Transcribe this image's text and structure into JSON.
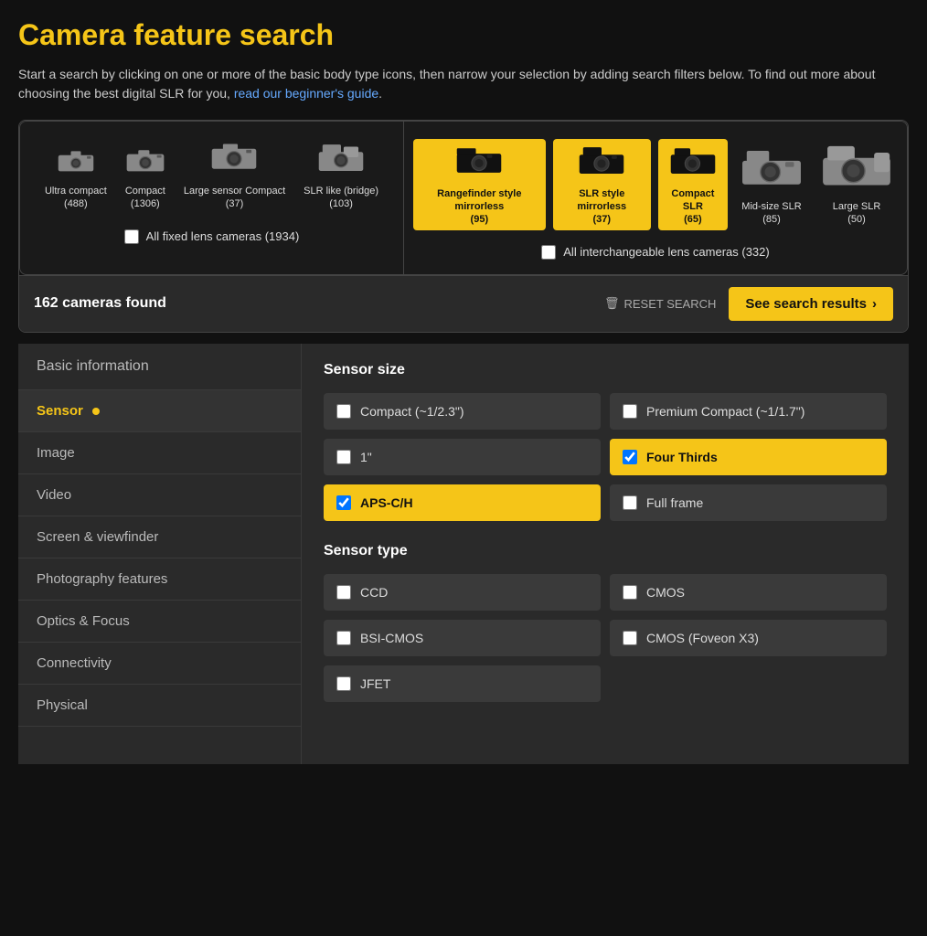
{
  "page": {
    "title": "Camera feature search",
    "description": "Start a search by clicking on one or more of the basic body type icons, then narrow your selection by adding search filters below. To find out more about choosing the best digital SLR for you,",
    "link_text": "read our beginner's guide",
    "cameras_found": "162 cameras found",
    "reset_label": "RESET SEARCH",
    "see_results_label": "See search results"
  },
  "fixed_cameras": [
    {
      "label": "Ultra compact",
      "count": "(488)",
      "selected": false,
      "size": "sm"
    },
    {
      "label": "Compact",
      "count": "(1306)",
      "selected": false,
      "size": "sm"
    },
    {
      "label": "Large sensor Compact",
      "count": "(37)",
      "selected": false,
      "size": "md"
    },
    {
      "label": "SLR like (bridge)",
      "count": "(103)",
      "selected": false,
      "size": "md"
    }
  ],
  "interchangeable_cameras": [
    {
      "label": "Rangefinder style mirrorless",
      "count": "(95)",
      "selected": true,
      "size": "md"
    },
    {
      "label": "SLR style mirrorless",
      "count": "(37)",
      "selected": true,
      "size": "md"
    },
    {
      "label": "Compact SLR",
      "count": "(65)",
      "selected": true,
      "size": "md"
    },
    {
      "label": "Mid-size SLR",
      "count": "(85)",
      "selected": false,
      "size": "lg"
    },
    {
      "label": "Large SLR",
      "count": "(50)",
      "selected": false,
      "size": "xl"
    }
  ],
  "all_fixed_label": "All fixed lens cameras (1934)",
  "all_interchangeable_label": "All interchangeable lens cameras (332)",
  "sidebar": {
    "section_header": "Basic information",
    "items": [
      {
        "id": "sensor",
        "label": "Sensor",
        "active": true,
        "has_dot": true
      },
      {
        "id": "image",
        "label": "Image",
        "active": false,
        "has_dot": false
      },
      {
        "id": "video",
        "label": "Video",
        "active": false,
        "has_dot": false
      },
      {
        "id": "screen-viewfinder",
        "label": "Screen & viewfinder",
        "active": false,
        "has_dot": false
      },
      {
        "id": "photography-features",
        "label": "Photography features",
        "active": false,
        "has_dot": false
      },
      {
        "id": "optics-focus",
        "label": "Optics & Focus",
        "active": false,
        "has_dot": false
      },
      {
        "id": "connectivity",
        "label": "Connectivity",
        "active": false,
        "has_dot": false
      },
      {
        "id": "physical",
        "label": "Physical",
        "active": false,
        "has_dot": false
      }
    ]
  },
  "filter_panel": {
    "sensor_size_title": "Sensor size",
    "sensor_type_title": "Sensor type",
    "sensor_size_options": [
      {
        "id": "compact-sensor",
        "label": "Compact (~1/2.3\")",
        "checked": false
      },
      {
        "id": "premium-compact",
        "label": "Premium Compact (~1/1.7\")",
        "checked": false
      },
      {
        "id": "one-inch",
        "label": "1\"",
        "checked": false
      },
      {
        "id": "four-thirds",
        "label": "Four Thirds",
        "checked": true
      },
      {
        "id": "aps-c-h",
        "label": "APS-C/H",
        "checked": true
      },
      {
        "id": "full-frame",
        "label": "Full frame",
        "checked": false
      }
    ],
    "sensor_type_options": [
      {
        "id": "ccd",
        "label": "CCD",
        "checked": false
      },
      {
        "id": "cmos",
        "label": "CMOS",
        "checked": false
      },
      {
        "id": "bsi-cmos",
        "label": "BSI-CMOS",
        "checked": false
      },
      {
        "id": "cmos-foveon",
        "label": "CMOS (Foveon X3)",
        "checked": false
      },
      {
        "id": "jfet",
        "label": "JFET",
        "checked": false
      }
    ]
  }
}
